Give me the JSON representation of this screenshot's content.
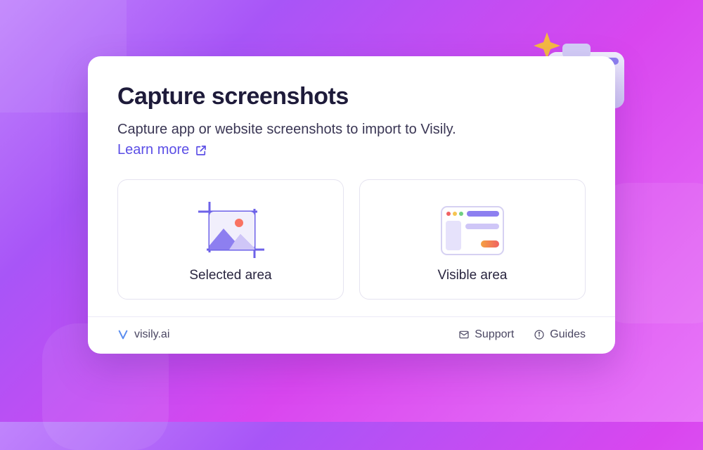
{
  "header": {
    "title": "Capture screenshots",
    "subtitle": "Capture app or website screenshots to import to Visily.",
    "learn_more_label": "Learn more"
  },
  "options": [
    {
      "id": "selected-area",
      "label": "Selected area",
      "icon": "crop-image-icon"
    },
    {
      "id": "visible-area",
      "label": "Visible area",
      "icon": "browser-window-icon"
    }
  ],
  "footer": {
    "brand": "visily.ai",
    "support_label": "Support",
    "guides_label": "Guides"
  },
  "colors": {
    "accent": "#5b4ee6",
    "text": "#1e1b3a"
  }
}
